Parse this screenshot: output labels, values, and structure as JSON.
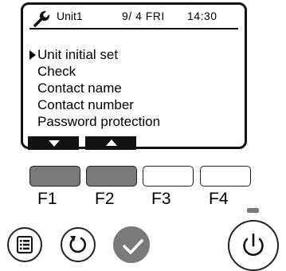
{
  "status": {
    "unit": "Unit1",
    "date": "9/ 4 FRI",
    "time": "14:30"
  },
  "menu": {
    "items": [
      {
        "label": "Unit initial set",
        "selected": true
      },
      {
        "label": "Check"
      },
      {
        "label": "Contact name"
      },
      {
        "label": "Contact number"
      },
      {
        "label": "Password protection"
      }
    ]
  },
  "softkeys": [
    "down-arrow-icon",
    "up-arrow-icon"
  ],
  "function_buttons": [
    "F1",
    "F2",
    "F3",
    "F4"
  ],
  "icons": {
    "status": "wrench-icon",
    "menu_button": "menu-list-icon",
    "back_button": "back-arrow-icon",
    "ok_button": "checkmark-icon",
    "power_button": "power-icon"
  },
  "colors": {
    "active_button": "#7a7a7a",
    "screen_border": "#111111"
  }
}
